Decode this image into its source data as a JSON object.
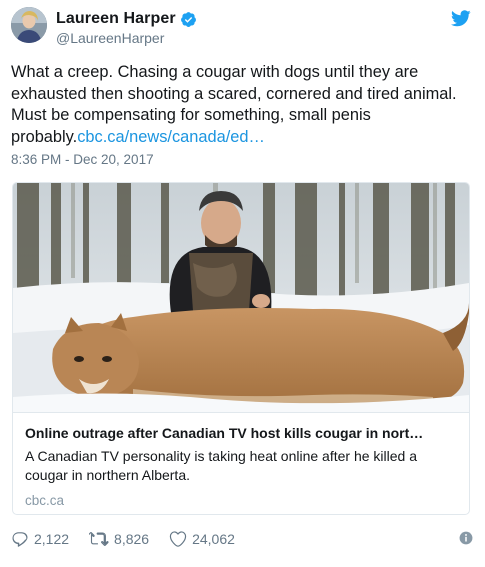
{
  "author": {
    "display_name": "Laureen Harper",
    "handle": "@LaureenHarper",
    "verified": true
  },
  "tweet": {
    "text": "What a creep. Chasing a cougar with dogs until they are exhausted then shooting a scared, cornered and tired animal. Must be compensating for something, small penis probably.",
    "link_text": "cbc.ca/news/canada/ed…",
    "timestamp": "8:36 PM - Dec 20, 2017"
  },
  "card": {
    "title": "Online outrage after Canadian TV host kills cougar in nort…",
    "description": "A Canadian TV personality is taking heat online after he killed a cougar in northern Alberta.",
    "domain": "cbc.ca"
  },
  "actions": {
    "replies": "2,122",
    "retweets": "8,826",
    "likes": "24,062"
  },
  "icons": {
    "brand": "twitter-bird-icon",
    "verified": "verified-badge-icon",
    "reply": "reply-icon",
    "retweet": "retweet-icon",
    "like": "heart-icon",
    "info": "info-icon"
  },
  "colors": {
    "link": "#1b95e0",
    "brand": "#1da1f2",
    "muted": "#657786"
  }
}
